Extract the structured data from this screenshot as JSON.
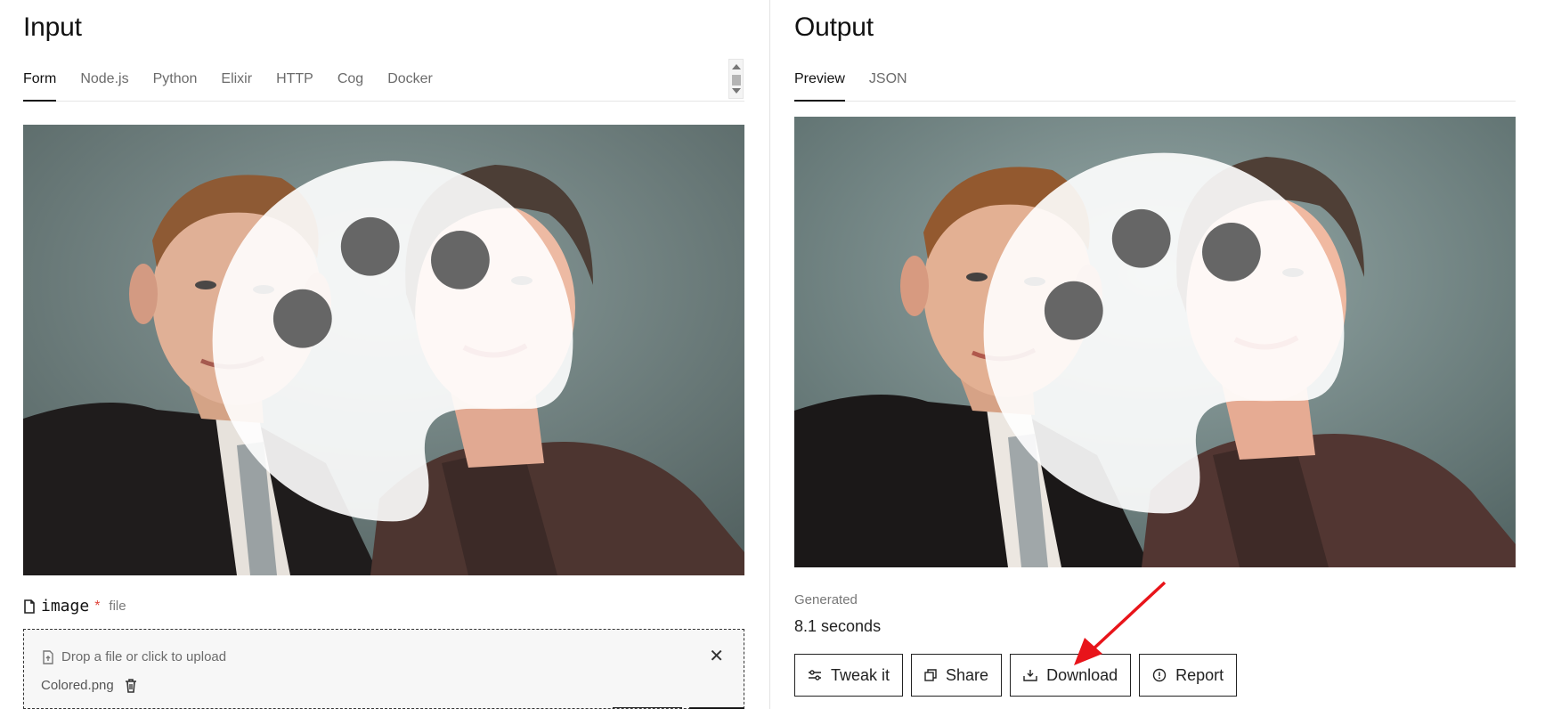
{
  "input": {
    "title": "Input",
    "tabs": [
      "Form",
      "Node.js",
      "Python",
      "Elixir",
      "HTTP",
      "Cog",
      "Docker"
    ],
    "field": {
      "name": "image",
      "required_mark": "*",
      "type": "file"
    },
    "dropzone": {
      "hint": "Drop a file or click to upload",
      "filename": "Colored.png"
    }
  },
  "output": {
    "title": "Output",
    "tabs": [
      "Preview",
      "JSON"
    ],
    "generated_label": "Generated",
    "generated_value": "8.1 seconds",
    "actions": [
      "Tweak it",
      "Share",
      "Download",
      "Report"
    ]
  },
  "icons": {
    "palette": "palette-icon",
    "file": "file-icon",
    "upload": "upload-file-icon",
    "close": "close-icon",
    "trash": "trash-icon",
    "tweak": "sliders-icon",
    "share": "copy-icon",
    "download": "download-icon",
    "report": "alert-circle-icon"
  },
  "colors": {
    "annotation_arrow": "#e8141a"
  }
}
